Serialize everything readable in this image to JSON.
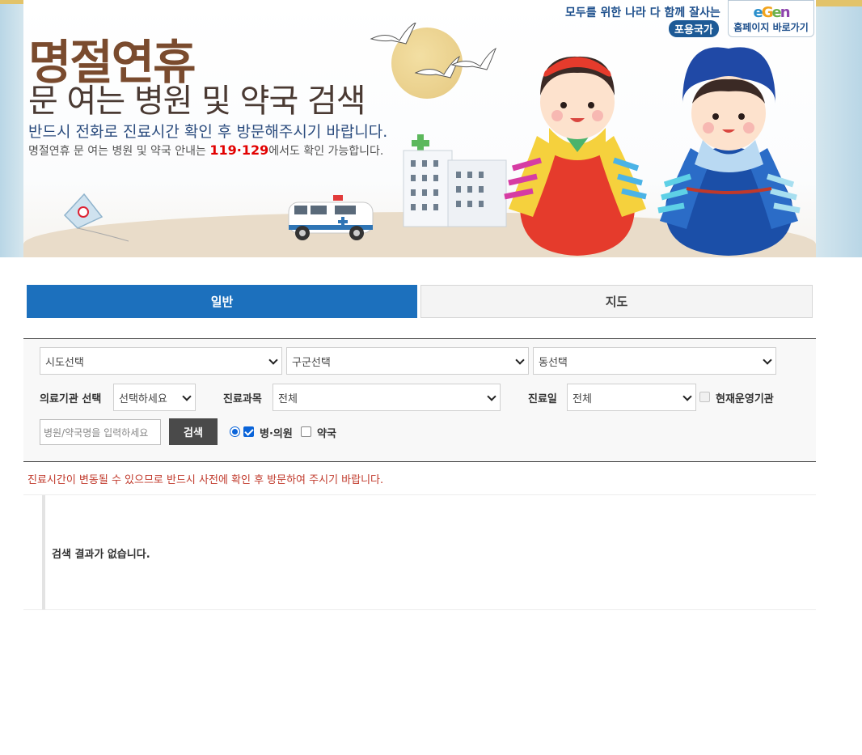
{
  "banner": {
    "title": "명절연휴",
    "subtitle": "문 여는 병원 및 약국 검색",
    "notice_primary": "반드시 전화로 진료시간 확인 후 방문해주시기 바랍니다.",
    "notice_secondary_before": "명절연휴 문 여는 병원 및 약국 안내는 ",
    "notice_secondary_emphasis": "119·129",
    "notice_secondary_after": "에서도 확인 가능합니다.",
    "slogan": "모두를 위한 나라 다 함께 잘사는",
    "slogan_badge": "포용국가",
    "home_logo": "egen",
    "home_link_label": "홈페이지 바로가기"
  },
  "tabs": [
    {
      "label": "일반",
      "active": true
    },
    {
      "label": "지도",
      "active": false
    }
  ],
  "filters": {
    "sido_select": "시도선택",
    "gugun_select": "구군선택",
    "dong_select": "동선택",
    "institution_label": "의료기관 선택",
    "institution_select": "선택하세요",
    "department_label": "진료과목",
    "department_select": "전체",
    "day_label": "진료일",
    "day_select": "전체",
    "operating_now_label": "현재운영기관",
    "operating_now_checked": false,
    "search_placeholder": "병원/약국명을 입력하세요",
    "search_button": "검색",
    "hospital_label": "병·의원",
    "hospital_checked": true,
    "pharmacy_label": "약국",
    "pharmacy_checked": false
  },
  "warning": "진료시간이 변동될 수 있으므로 반드시 사전에 확인 후 방문하여 주시기 바랍니다.",
  "results": {
    "empty_message": "검색 결과가 없습니다."
  },
  "colors": {
    "tab_active": "#1c70bd",
    "title_brown": "#7a4b2e",
    "emphasis_red": "#e20000",
    "warning_red": "#c0392b",
    "search_button": "#4a4a4a"
  }
}
